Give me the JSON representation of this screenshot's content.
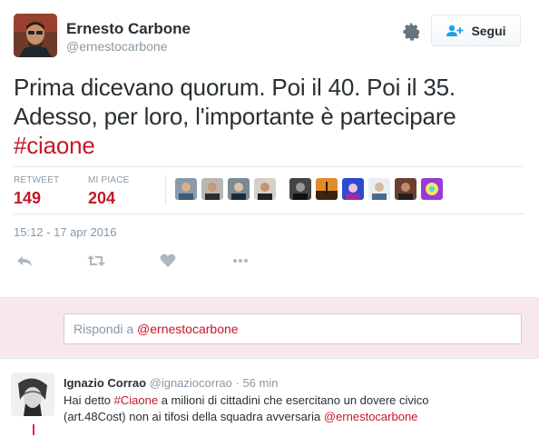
{
  "tweet": {
    "author_name": "Ernesto Carbone",
    "author_handle": "@ernestocarbone",
    "follow_label": "Segui",
    "text_line1": "Prima dicevano quorum. Poi il 40. Poi il 35.",
    "text_line2": "Adesso, per loro, l'importante è partecipare",
    "hashtag": "#ciaone",
    "retweet_label": "RETWEET",
    "retweet_count": "149",
    "likes_label": "MI PIACE",
    "likes_count": "204",
    "timestamp": "15:12 - 17 apr 2016"
  },
  "reply_box": {
    "prefix": "Rispondi a ",
    "mention": "@ernestocarbone"
  },
  "reply": {
    "name": "Ignazio Corrao",
    "handle": "@ignaziocorrao",
    "sep": " · ",
    "time": "56 min",
    "text_part1": "Hai detto ",
    "hashtag": "#Ciaone",
    "text_part2": " a milioni di cittadini che esercitano un dovere civico",
    "text_part3": "(art.48Cost) non ai tifosi della squadra avversaria ",
    "mention": "@ernestocarbone"
  },
  "colors": {
    "accent": "#c41829",
    "muted": "#8899a6",
    "reply_bg": "#f8e8eb"
  },
  "icons": {
    "gear": "gear-icon",
    "follow": "add-user-icon",
    "reply": "reply-icon",
    "retweet": "retweet-icon",
    "like": "heart-icon",
    "more": "more-icon"
  }
}
